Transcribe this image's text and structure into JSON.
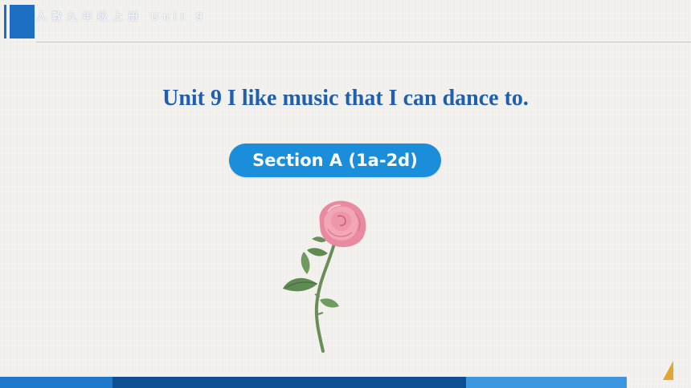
{
  "header": {
    "text": "人教九年级上册 Unit 9"
  },
  "slide": {
    "title": "Unit 9 I like music that I can dance to.",
    "section_label": "Section A (1a-2d)"
  },
  "images": {
    "rose": "rose-illustration"
  },
  "colors": {
    "accent_blue": "#1d6fc4",
    "title_blue": "#1f5fb0",
    "pill_blue": "#1a8ddb",
    "bottom_dark": "#0c4f93",
    "corner_orange": "#e5a533"
  }
}
